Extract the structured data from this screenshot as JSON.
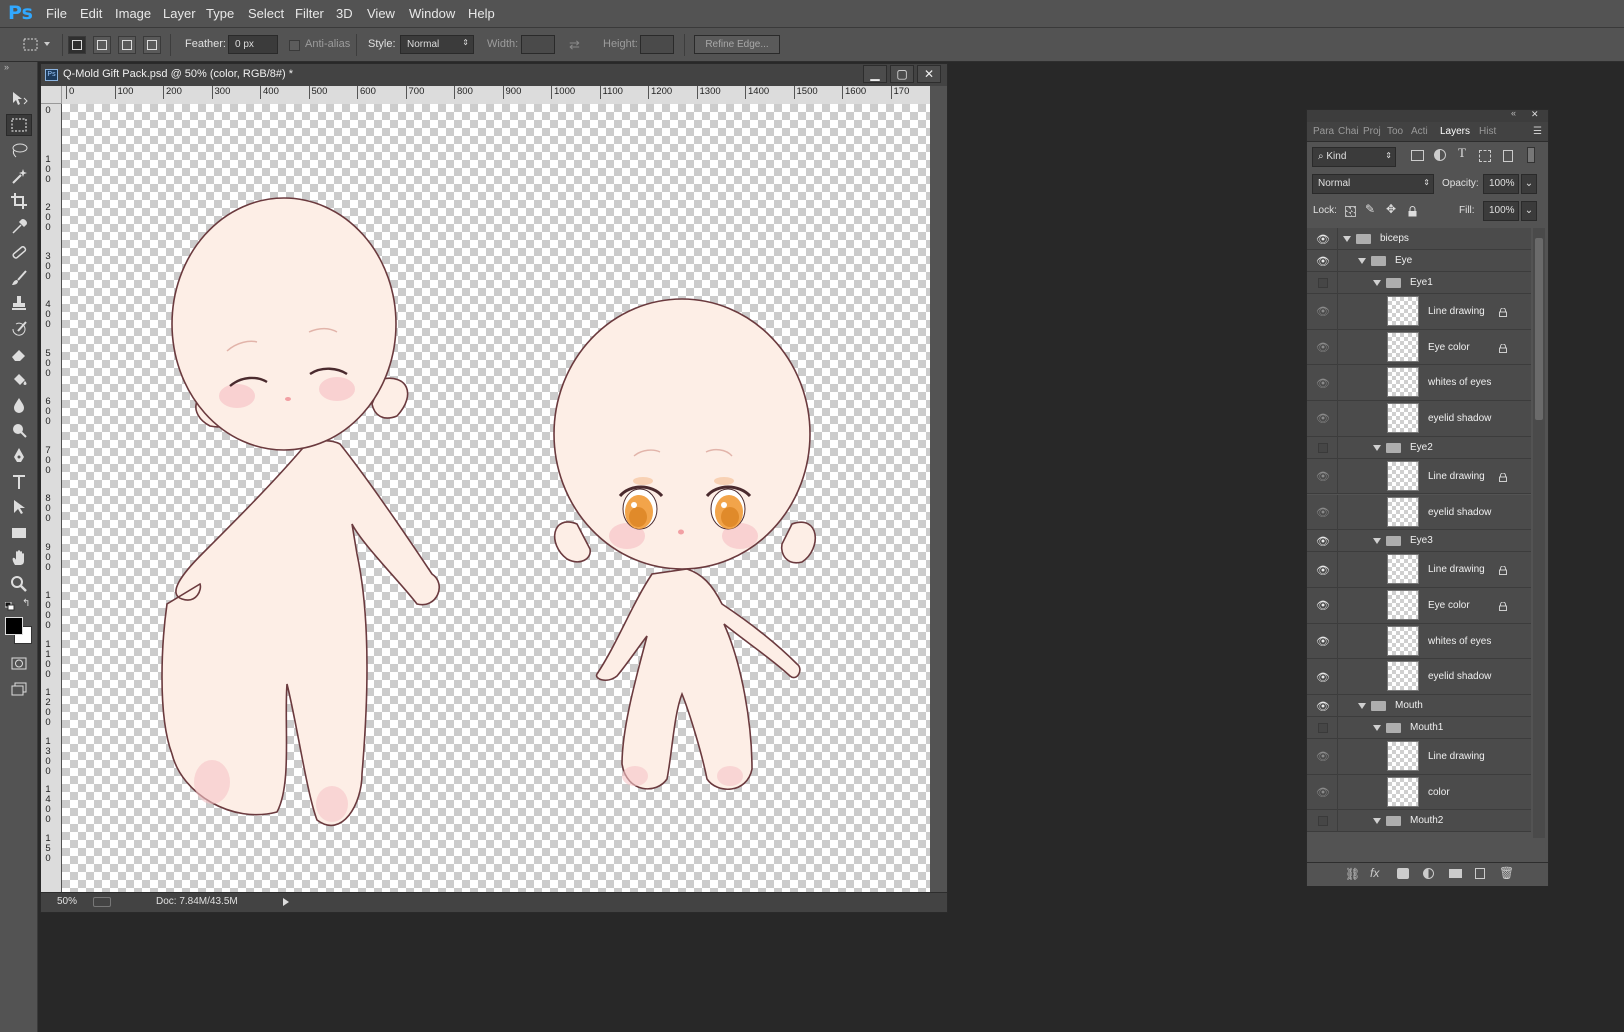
{
  "app": {
    "logo": "Ps"
  },
  "menu": [
    "File",
    "Edit",
    "Image",
    "Layer",
    "Type",
    "Select",
    "Filter",
    "3D",
    "View",
    "Window",
    "Help"
  ],
  "options": {
    "feather_label": "Feather:",
    "feather_value": "0 px",
    "antialias_label": "Anti-alias",
    "style_label": "Style:",
    "style_value": "Normal",
    "width_label": "Width:",
    "height_label": "Height:",
    "refine_label": "Refine Edge..."
  },
  "document": {
    "title": "Q-Mold Gift Pack.psd @ 50% (color, RGB/8#) *",
    "icon_label": "Ps",
    "zoom": "50%",
    "doc_size": "Doc: 7.84M/43.5M",
    "hruler": [
      "0",
      "100",
      "200",
      "300",
      "400",
      "500",
      "600",
      "700",
      "800",
      "900",
      "1000",
      "1100",
      "1200",
      "1300",
      "1400",
      "1500",
      "1600",
      "170"
    ],
    "vruler": [
      "0",
      "1 0 0",
      "2 0 0",
      "3 0 0",
      "4 0 0",
      "5 0 0",
      "6 0 0",
      "7 0 0",
      "8 0 0",
      "9 0 0",
      "1 0 0 0",
      "1 1 0 0",
      "1 2 0 0",
      "1 3 0 0",
      "1 4 0 0",
      "1 5 0"
    ]
  },
  "panel": {
    "tabs": [
      "Para",
      "Chai",
      "Proj",
      "Too",
      "Acti",
      "Layers",
      "Hist"
    ],
    "active_tab": "Layers",
    "kind_label": "Kind",
    "blend_mode": "Normal",
    "opacity_label": "Opacity:",
    "opacity_value": "100%",
    "lock_label": "Lock:",
    "fill_label": "Fill:",
    "fill_value": "100%"
  },
  "layers": [
    {
      "name": "biceps",
      "type": "group",
      "depth": 0,
      "visible": true
    },
    {
      "name": "Eye",
      "type": "group",
      "depth": 1,
      "visible": true
    },
    {
      "name": "Eye1",
      "type": "group",
      "depth": 2,
      "visible": false
    },
    {
      "name": "Line drawing",
      "type": "layer",
      "depth": 3,
      "visible": "dim",
      "locked": true
    },
    {
      "name": "Eye color",
      "type": "layer",
      "depth": 3,
      "visible": "dim",
      "locked": true
    },
    {
      "name": "whites of eyes",
      "type": "layer",
      "depth": 3,
      "visible": "dim",
      "locked": false
    },
    {
      "name": "eyelid shadow",
      "type": "layer",
      "depth": 3,
      "visible": "dim",
      "locked": false
    },
    {
      "name": "Eye2",
      "type": "group",
      "depth": 2,
      "visible": false
    },
    {
      "name": "Line drawing",
      "type": "layer",
      "depth": 3,
      "visible": "dim",
      "locked": true
    },
    {
      "name": "eyelid shadow",
      "type": "layer",
      "depth": 3,
      "visible": "dim",
      "locked": false
    },
    {
      "name": "Eye3",
      "type": "group",
      "depth": 2,
      "visible": true
    },
    {
      "name": "Line drawing",
      "type": "layer",
      "depth": 3,
      "visible": true,
      "locked": true
    },
    {
      "name": "Eye color",
      "type": "layer",
      "depth": 3,
      "visible": true,
      "locked": true
    },
    {
      "name": "whites of eyes",
      "type": "layer",
      "depth": 3,
      "visible": true,
      "locked": false
    },
    {
      "name": "eyelid shadow",
      "type": "layer",
      "depth": 3,
      "visible": true,
      "locked": false
    },
    {
      "name": "Mouth",
      "type": "group",
      "depth": 1,
      "visible": true
    },
    {
      "name": "Mouth1",
      "type": "group",
      "depth": 2,
      "visible": false
    },
    {
      "name": "Line drawing",
      "type": "layer",
      "depth": 3,
      "visible": "dim",
      "locked": false
    },
    {
      "name": "color",
      "type": "layer",
      "depth": 3,
      "visible": "dim",
      "locked": false
    },
    {
      "name": "Mouth2",
      "type": "group",
      "depth": 2,
      "visible": false
    }
  ],
  "tools": [
    "move-tool",
    "marquee-tool",
    "lasso-tool",
    "magic-wand-tool",
    "crop-tool",
    "eyedropper-tool",
    "healing-brush-tool",
    "brush-tool",
    "clone-stamp-tool",
    "history-brush-tool",
    "eraser-tool",
    "paint-bucket-tool",
    "blur-tool",
    "dodge-tool",
    "pen-tool",
    "type-tool",
    "path-selection-tool",
    "rectangle-tool",
    "hand-tool",
    "zoom-tool"
  ],
  "colors": {
    "skin": "#fdeee6",
    "outline": "#6b3a3e",
    "blush": "#f6c4c8",
    "iris": "#f2a44a",
    "accent": "#31a8ff"
  }
}
